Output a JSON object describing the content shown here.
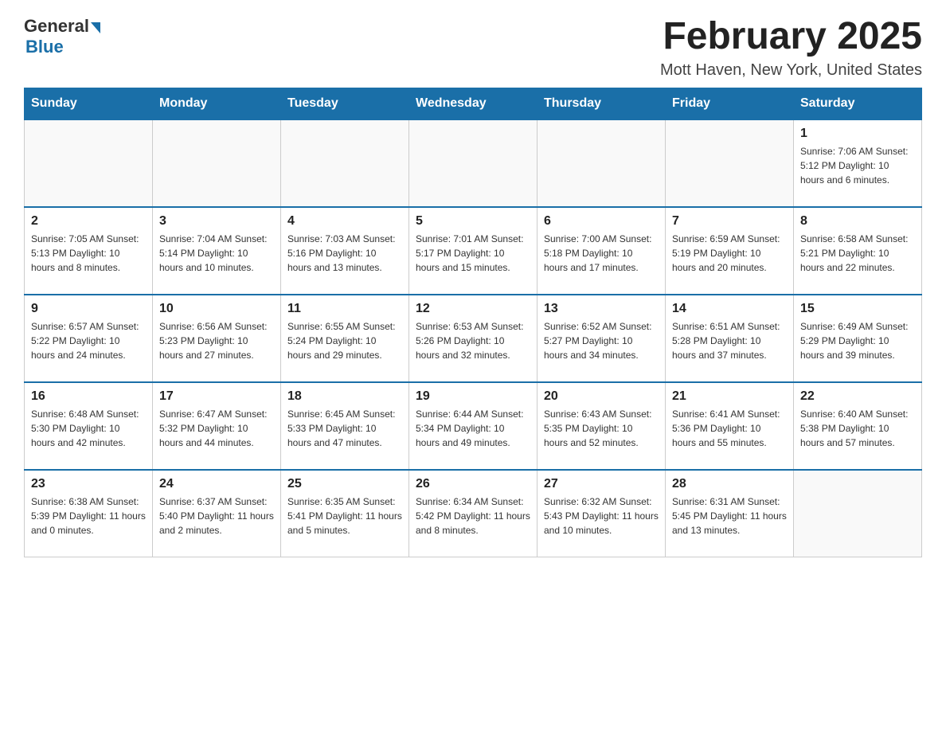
{
  "header": {
    "logo_general": "General",
    "logo_blue": "Blue",
    "title": "February 2025",
    "location": "Mott Haven, New York, United States"
  },
  "weekdays": [
    "Sunday",
    "Monday",
    "Tuesday",
    "Wednesday",
    "Thursday",
    "Friday",
    "Saturday"
  ],
  "weeks": [
    [
      {
        "day": "",
        "info": ""
      },
      {
        "day": "",
        "info": ""
      },
      {
        "day": "",
        "info": ""
      },
      {
        "day": "",
        "info": ""
      },
      {
        "day": "",
        "info": ""
      },
      {
        "day": "",
        "info": ""
      },
      {
        "day": "1",
        "info": "Sunrise: 7:06 AM\nSunset: 5:12 PM\nDaylight: 10 hours and 6 minutes."
      }
    ],
    [
      {
        "day": "2",
        "info": "Sunrise: 7:05 AM\nSunset: 5:13 PM\nDaylight: 10 hours and 8 minutes."
      },
      {
        "day": "3",
        "info": "Sunrise: 7:04 AM\nSunset: 5:14 PM\nDaylight: 10 hours and 10 minutes."
      },
      {
        "day": "4",
        "info": "Sunrise: 7:03 AM\nSunset: 5:16 PM\nDaylight: 10 hours and 13 minutes."
      },
      {
        "day": "5",
        "info": "Sunrise: 7:01 AM\nSunset: 5:17 PM\nDaylight: 10 hours and 15 minutes."
      },
      {
        "day": "6",
        "info": "Sunrise: 7:00 AM\nSunset: 5:18 PM\nDaylight: 10 hours and 17 minutes."
      },
      {
        "day": "7",
        "info": "Sunrise: 6:59 AM\nSunset: 5:19 PM\nDaylight: 10 hours and 20 minutes."
      },
      {
        "day": "8",
        "info": "Sunrise: 6:58 AM\nSunset: 5:21 PM\nDaylight: 10 hours and 22 minutes."
      }
    ],
    [
      {
        "day": "9",
        "info": "Sunrise: 6:57 AM\nSunset: 5:22 PM\nDaylight: 10 hours and 24 minutes."
      },
      {
        "day": "10",
        "info": "Sunrise: 6:56 AM\nSunset: 5:23 PM\nDaylight: 10 hours and 27 minutes."
      },
      {
        "day": "11",
        "info": "Sunrise: 6:55 AM\nSunset: 5:24 PM\nDaylight: 10 hours and 29 minutes."
      },
      {
        "day": "12",
        "info": "Sunrise: 6:53 AM\nSunset: 5:26 PM\nDaylight: 10 hours and 32 minutes."
      },
      {
        "day": "13",
        "info": "Sunrise: 6:52 AM\nSunset: 5:27 PM\nDaylight: 10 hours and 34 minutes."
      },
      {
        "day": "14",
        "info": "Sunrise: 6:51 AM\nSunset: 5:28 PM\nDaylight: 10 hours and 37 minutes."
      },
      {
        "day": "15",
        "info": "Sunrise: 6:49 AM\nSunset: 5:29 PM\nDaylight: 10 hours and 39 minutes."
      }
    ],
    [
      {
        "day": "16",
        "info": "Sunrise: 6:48 AM\nSunset: 5:30 PM\nDaylight: 10 hours and 42 minutes."
      },
      {
        "day": "17",
        "info": "Sunrise: 6:47 AM\nSunset: 5:32 PM\nDaylight: 10 hours and 44 minutes."
      },
      {
        "day": "18",
        "info": "Sunrise: 6:45 AM\nSunset: 5:33 PM\nDaylight: 10 hours and 47 minutes."
      },
      {
        "day": "19",
        "info": "Sunrise: 6:44 AM\nSunset: 5:34 PM\nDaylight: 10 hours and 49 minutes."
      },
      {
        "day": "20",
        "info": "Sunrise: 6:43 AM\nSunset: 5:35 PM\nDaylight: 10 hours and 52 minutes."
      },
      {
        "day": "21",
        "info": "Sunrise: 6:41 AM\nSunset: 5:36 PM\nDaylight: 10 hours and 55 minutes."
      },
      {
        "day": "22",
        "info": "Sunrise: 6:40 AM\nSunset: 5:38 PM\nDaylight: 10 hours and 57 minutes."
      }
    ],
    [
      {
        "day": "23",
        "info": "Sunrise: 6:38 AM\nSunset: 5:39 PM\nDaylight: 11 hours and 0 minutes."
      },
      {
        "day": "24",
        "info": "Sunrise: 6:37 AM\nSunset: 5:40 PM\nDaylight: 11 hours and 2 minutes."
      },
      {
        "day": "25",
        "info": "Sunrise: 6:35 AM\nSunset: 5:41 PM\nDaylight: 11 hours and 5 minutes."
      },
      {
        "day": "26",
        "info": "Sunrise: 6:34 AM\nSunset: 5:42 PM\nDaylight: 11 hours and 8 minutes."
      },
      {
        "day": "27",
        "info": "Sunrise: 6:32 AM\nSunset: 5:43 PM\nDaylight: 11 hours and 10 minutes."
      },
      {
        "day": "28",
        "info": "Sunrise: 6:31 AM\nSunset: 5:45 PM\nDaylight: 11 hours and 13 minutes."
      },
      {
        "day": "",
        "info": ""
      }
    ]
  ]
}
